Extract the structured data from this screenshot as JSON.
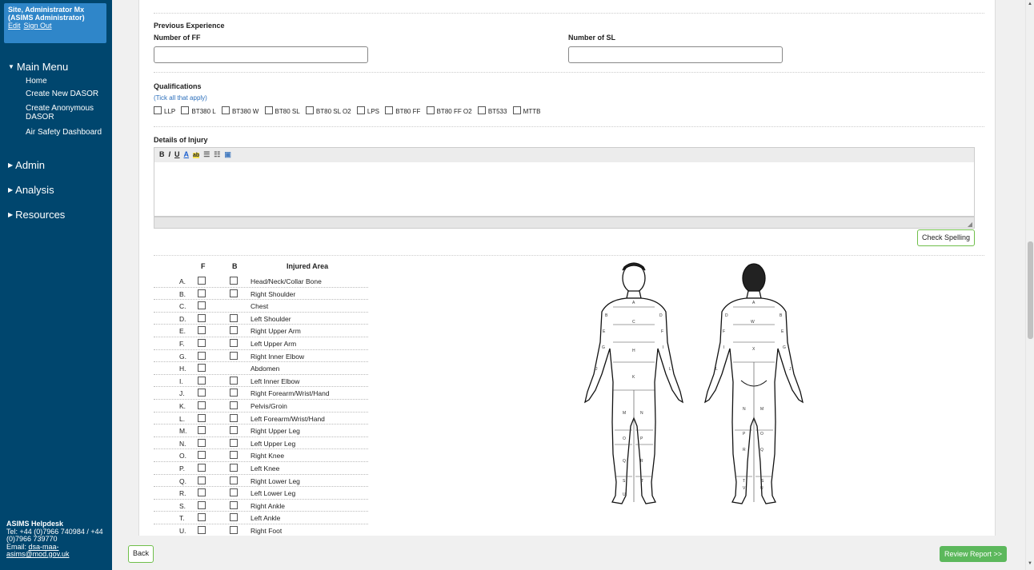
{
  "sidebar": {
    "user_name": "Site, Administrator Mx",
    "user_role": "(ASIMS Administrator)",
    "edit_link": "Edit",
    "signout_link": "Sign Out",
    "main_menu": "Main Menu",
    "menu_items": [
      "Home",
      "Create New DASOR",
      "Create Anonymous DASOR",
      "Air Safety Dashboard"
    ],
    "admin": "Admin",
    "analysis": "Analysis",
    "resources": "Resources",
    "helpdesk": {
      "title": "ASIMS Helpdesk",
      "tel": "Tel: +44 (0)7966 740984 / +44 (0)7966 739770",
      "email_label": "Email:",
      "email": "dsa-maa-asims@mod.gov.uk"
    }
  },
  "form": {
    "previous_experience": "Previous Experience",
    "number_ff": "Number of FF",
    "number_sl": "Number of SL",
    "qualifications": "Qualifications",
    "tick_all": "(Tick all that apply)",
    "quals": [
      "LLP",
      "BT380 L",
      "BT380 W",
      "BT80 SL",
      "BT80 SL O2",
      "LPS",
      "BT80 FF",
      "BT80 FF O2",
      "BT533",
      "MTTB"
    ],
    "details_of_injury": "Details of Injury",
    "check_spelling": "Check Spelling",
    "toolbar": [
      "B",
      "I",
      "U",
      "A",
      "ab",
      "☰",
      "☷",
      "▣"
    ]
  },
  "injury_table": {
    "col_f": "F",
    "col_b": "B",
    "col_area": "Injured Area",
    "rows": [
      {
        "letter": "A.",
        "area": "Head/Neck/Collar Bone",
        "b": true
      },
      {
        "letter": "B.",
        "area": "Right Shoulder",
        "b": true
      },
      {
        "letter": "C.",
        "area": "Chest",
        "b": false
      },
      {
        "letter": "D.",
        "area": "Left Shoulder",
        "b": true
      },
      {
        "letter": "E.",
        "area": "Right Upper Arm",
        "b": true
      },
      {
        "letter": "F.",
        "area": "Left Upper Arm",
        "b": true
      },
      {
        "letter": "G.",
        "area": "Right Inner Elbow",
        "b": true
      },
      {
        "letter": "H.",
        "area": "Abdomen",
        "b": false
      },
      {
        "letter": "I.",
        "area": "Left Inner Elbow",
        "b": true
      },
      {
        "letter": "J.",
        "area": "Right Forearm/Wrist/Hand",
        "b": true
      },
      {
        "letter": "K.",
        "area": "Pelvis/Groin",
        "b": true
      },
      {
        "letter": "L.",
        "area": "Left Forearm/Wrist/Hand",
        "b": true
      },
      {
        "letter": "M.",
        "area": "Right Upper Leg",
        "b": true
      },
      {
        "letter": "N.",
        "area": "Left Upper Leg",
        "b": true
      },
      {
        "letter": "O.",
        "area": "Right Knee",
        "b": true
      },
      {
        "letter": "P.",
        "area": "Left Knee",
        "b": true
      },
      {
        "letter": "Q.",
        "area": "Right Lower Leg",
        "b": true
      },
      {
        "letter": "R.",
        "area": "Left Lower Leg",
        "b": true
      },
      {
        "letter": "S.",
        "area": "Right Ankle",
        "b": true
      },
      {
        "letter": "T.",
        "area": "Left Ankle",
        "b": true
      },
      {
        "letter": "U.",
        "area": "Right Foot",
        "b": true
      }
    ]
  },
  "footer": {
    "back": "Back",
    "review": "Review Report >>"
  },
  "colors": {
    "sidebar": "#00466e",
    "user_box": "#2f86c9",
    "accent_green": "#5cb85c"
  }
}
